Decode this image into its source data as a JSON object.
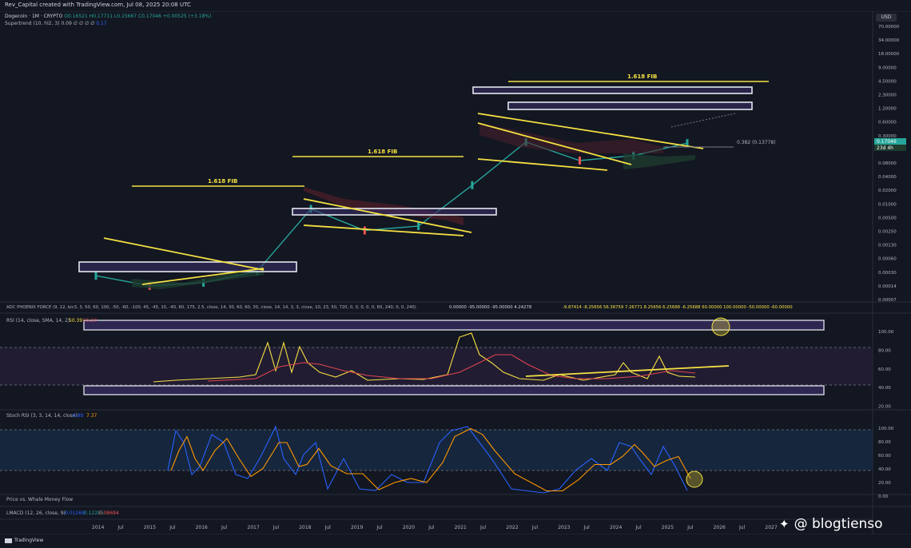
{
  "header": {
    "created": "Rev_Capital created with TradingView.com, Jul 08, 2025 20:08 UTC"
  },
  "legend": {
    "symbol": "Dogecoin · 1M · CRYPTO",
    "ohlc": "O0.16521 H0.17711 L0.15667 C0.17046 +0.00525 (+3.18%)",
    "supertrend_label": "Supertrend (10, hl2, 3)",
    "supertrend_values": "0.09 ∅ ∅ ∅ ∅",
    "supertrend_value2": "0.17"
  },
  "price_scale": {
    "currency": "USD",
    "labels": [
      "70.00000",
      "34.00000",
      "18.00000",
      "9.00000",
      "4.50000",
      "2.30000",
      "1.20000",
      "0.60000",
      "0.30000",
      "0.16000",
      "0.08000",
      "0.04000",
      "0.02000",
      "0.01000",
      "0.00500",
      "0.00250",
      "0.00130",
      "0.00060",
      "0.00030",
      "0.00014",
      "0.00007"
    ],
    "current_price": "0.17046",
    "countdown": "23d 4h"
  },
  "annotations": {
    "fib1": "1.618 FIB",
    "fib2": "1.618 FIB",
    "fib3": "1.618 FIB",
    "fib_level": "0.382 (0.13778)"
  },
  "indicator_line": {
    "adc": "ADC PHOENIX FORCE (9, 12, bic3, 3, 50, 60, 100, -50, -60, -100, 45, -45, 15, -40, 60, 175, 2.5, close, 14, 30, 60, 60, 30, close, 14, 14, 3, 3, close, 10, 23, 50, 720, 0, 0, 0, 0, 0, 60, 240, 0, 0, 240)",
    "adc_values": "0.00000 -95.00000 -95.00000 4.24278",
    "adc_values2": "-9.87414 -8.25656 56.38759 7.26771 8.25656 6.25688 -6.25688 60.00000 100.00000 -50.00000 -60.00000"
  },
  "rsi": {
    "label": "RSI (14, close, SMA, 14, 2)",
    "value": "50.39",
    "value2": "55.10",
    "scale": [
      "100.00",
      "80.00",
      "60.00",
      "40.00",
      "20.00"
    ]
  },
  "stoch": {
    "label": "Stoch RSI (3, 3, 14, 14, close)",
    "k": "6.89",
    "d": "7.37",
    "scale": [
      "100.00",
      "80.00",
      "60.00",
      "40.00",
      "20.00",
      "0.00"
    ]
  },
  "whale": {
    "label": "Price vs. Whale Money Flow"
  },
  "lmacd": {
    "label": "LMACD (12, 26, close, 9)",
    "v1": "-0.01269",
    "v2": "0.12285",
    "v3": "0.08694"
  },
  "time_axis": [
    "2014",
    "Jul",
    "2015",
    "Jul",
    "2016",
    "Jul",
    "2017",
    "Jul",
    "2018",
    "Jul",
    "2019",
    "Jul",
    "2020",
    "Jul",
    "2021",
    "Jul",
    "2022",
    "Jul",
    "2023",
    "Jul",
    "2024",
    "Jul",
    "2025",
    "Jul",
    "2026",
    "Jul",
    "2027"
  ],
  "footer": {
    "brand": "TradingView"
  },
  "watermark": {
    "text": "@ blogtienso"
  },
  "colors": {
    "background": "#131722",
    "up": "#26a69a",
    "down": "#ef5350",
    "fib_yellow": "#f5e042",
    "rsi_line": "#f5e042",
    "rsi_ma": "#e0454f",
    "stoch_k": "#2962ff",
    "stoch_d": "#ff9800",
    "band": "#3c2f6b"
  },
  "chart_data": {
    "type": "line",
    "title": "Dogecoin · 1M · CRYPTO",
    "scale": "log",
    "x": [
      "2014",
      "2015",
      "2016",
      "2017",
      "2018",
      "2019",
      "2020",
      "2021",
      "2022",
      "2023",
      "2024",
      "2025"
    ],
    "series": [
      {
        "values": [
          0.0002,
          0.00012,
          0.00014,
          0.00025,
          0.006,
          0.002,
          0.0025,
          0.02,
          0.18,
          0.07,
          0.09,
          0.17
        ]
      }
    ],
    "ylim": [
      7e-05,
      70
    ]
  }
}
